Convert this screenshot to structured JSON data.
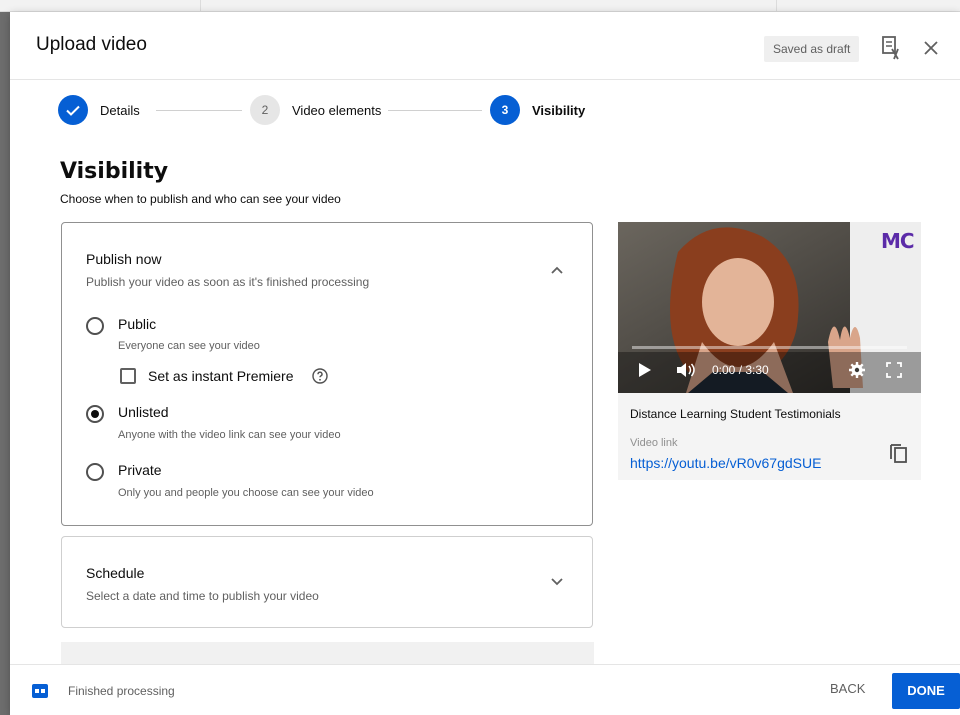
{
  "dialog": {
    "title": "Upload video",
    "draft_status": "Saved as draft"
  },
  "stepper": {
    "steps": [
      {
        "number": "",
        "label": "Details",
        "state": "completed"
      },
      {
        "number": "2",
        "label": "Video elements",
        "state": "pending"
      },
      {
        "number": "3",
        "label": "Visibility",
        "state": "active"
      }
    ]
  },
  "visibility": {
    "title": "Visibility",
    "subtitle": "Choose when to publish and who can see your video",
    "publish_now": {
      "title": "Publish now",
      "description": "Publish your video as soon as it's finished processing",
      "options": [
        {
          "label": "Public",
          "description": "Everyone can see your video",
          "selected": false
        },
        {
          "label": "Unlisted",
          "description": "Anyone with the video link can see your video",
          "selected": true
        },
        {
          "label": "Private",
          "description": "Only you and people you choose can see your video",
          "selected": false
        }
      ],
      "premiere_label": "Set as instant Premiere",
      "premiere_checked": false
    },
    "schedule": {
      "title": "Schedule",
      "description": "Select a date and time to publish your video"
    }
  },
  "video": {
    "brand_logo": "MC",
    "time": "0:00 / 3:30",
    "title": "Distance Learning Student Testimonials",
    "link_label": "Video link",
    "link_url": "https://youtu.be/vR0v67gdSUE"
  },
  "footer": {
    "status": "Finished processing",
    "back_label": "BACK",
    "done_label": "DONE"
  },
  "colors": {
    "accent": "#065fd4",
    "brand_purple": "#5b2ba8"
  }
}
